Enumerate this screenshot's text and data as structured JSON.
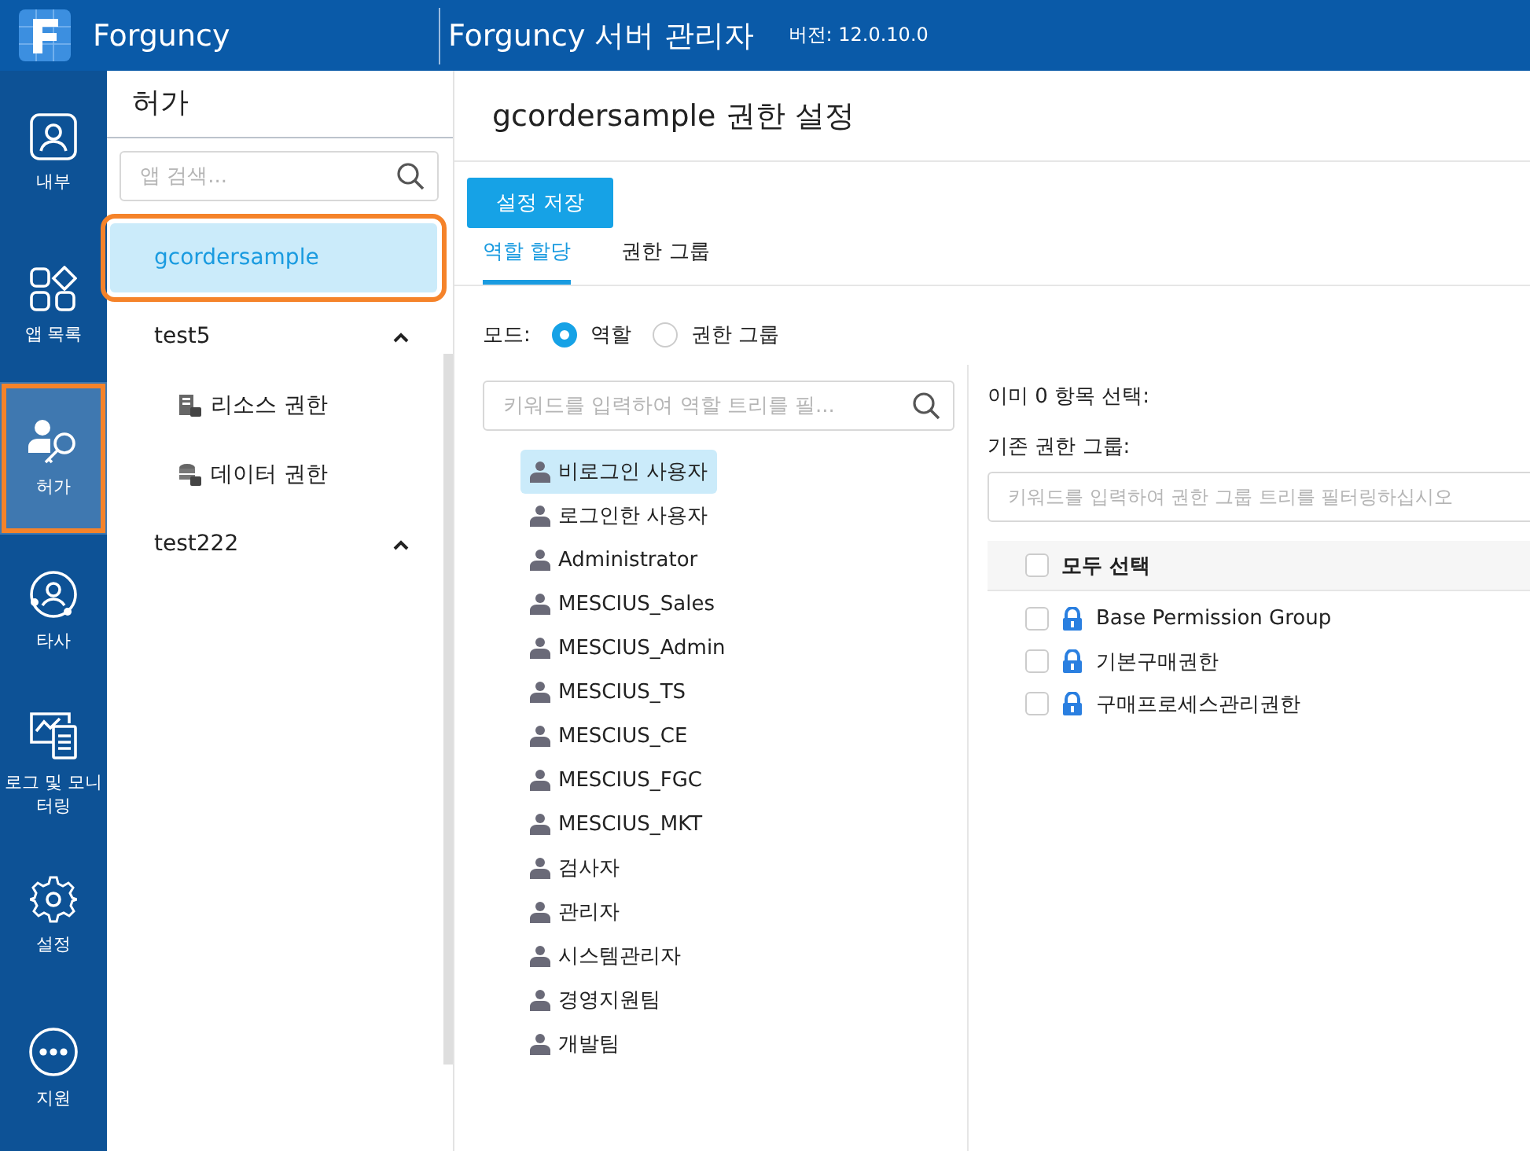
{
  "header": {
    "brand": "Forguncy",
    "title": "Forguncy 서버 관리자",
    "version": "버전: 12.0.10.0"
  },
  "rail": [
    {
      "kind": "user",
      "label": "내부",
      "selected": false
    },
    {
      "kind": "apps",
      "label": "앱 목록",
      "selected": false
    },
    {
      "kind": "key",
      "label": "허가",
      "selected": true
    },
    {
      "kind": "third",
      "label": "타사",
      "selected": false
    },
    {
      "kind": "monitor",
      "label": "로그 및 모니터링",
      "selected": false
    },
    {
      "kind": "gear",
      "label": "설정",
      "selected": false
    },
    {
      "kind": "more",
      "label": "지원",
      "selected": false
    }
  ],
  "sidebar": {
    "title": "허가",
    "search": {
      "placeholder": "앱 검색..."
    },
    "items": [
      {
        "label": "gcordersample",
        "selected": true
      },
      {
        "label": "test5",
        "selected": false,
        "expanded": true,
        "children": [
          {
            "kind": "resource",
            "label": "리소스 권한"
          },
          {
            "kind": "data",
            "label": "데이터 권한"
          }
        ]
      },
      {
        "label": "test222",
        "selected": false,
        "expanded": true
      }
    ]
  },
  "main": {
    "title": "gcordersample 권한 설정",
    "save_button": "설정 저장",
    "tabs": [
      {
        "label": "역할 할당",
        "selected": true
      },
      {
        "label": "권한 그룹",
        "selected": false
      }
    ],
    "mode": {
      "label": "모드:",
      "options": [
        {
          "label": "역할",
          "selected": true
        },
        {
          "label": "권한 그룹",
          "selected": false
        }
      ]
    },
    "roles": {
      "search": {
        "placeholder": "키워드를 입력하여 역할 트리를 필..."
      },
      "items": [
        {
          "label": "비로그인 사용자",
          "selected": true
        },
        {
          "label": "로그인한 사용자",
          "selected": false
        },
        {
          "label": "Administrator",
          "selected": false
        },
        {
          "label": "MESCIUS_Sales",
          "selected": false
        },
        {
          "label": "MESCIUS_Admin",
          "selected": false
        },
        {
          "label": "MESCIUS_TS",
          "selected": false
        },
        {
          "label": "MESCIUS_CE",
          "selected": false
        },
        {
          "label": "MESCIUS_FGC",
          "selected": false
        },
        {
          "label": "MESCIUS_MKT",
          "selected": false
        },
        {
          "label": "검사자",
          "selected": false
        },
        {
          "label": "관리자",
          "selected": false
        },
        {
          "label": "시스템관리자",
          "selected": false
        },
        {
          "label": "경영지원팀",
          "selected": false
        },
        {
          "label": "개발팀",
          "selected": false
        }
      ]
    },
    "groups": {
      "selected_count": "이미 0 항목 선택:",
      "existing_label": "기존 권한 그룹:",
      "search": {
        "placeholder": "키워드를 입력하여 권한 그룹 트리를 필터링하십시오"
      },
      "select_all": {
        "label": "모두 선택",
        "checked": false
      },
      "items": [
        {
          "label": "Base Permission Group",
          "checked": false
        },
        {
          "label": "기본구매권한",
          "checked": false
        },
        {
          "label": "구매프로세스관리권한",
          "checked": false
        }
      ]
    }
  }
}
